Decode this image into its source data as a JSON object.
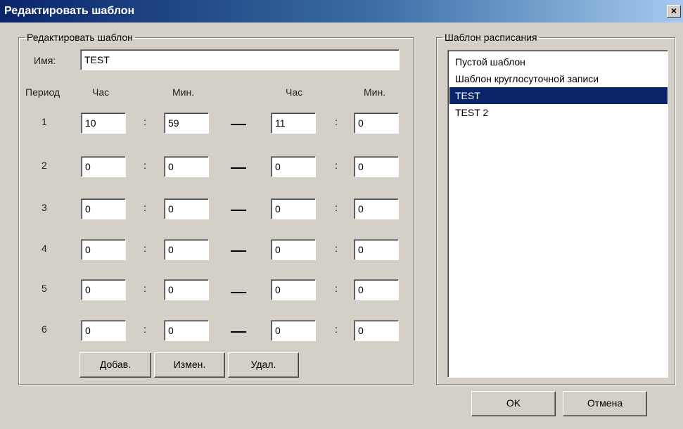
{
  "window": {
    "title": "Редактировать шаблон",
    "close_glyph": "×"
  },
  "edit_group": {
    "legend": "Редактировать шаблон",
    "name_label": "Имя:",
    "name_value": "TEST",
    "headers": {
      "period": "Период",
      "hour1": "Час",
      "min1": "Мин.",
      "hour2": "Час",
      "min2": "Мин."
    },
    "colon": ":",
    "periods": [
      {
        "num": "1",
        "start_hour": "10",
        "start_min": "59",
        "end_hour": "11",
        "end_min": "0"
      },
      {
        "num": "2",
        "start_hour": "0",
        "start_min": "0",
        "end_hour": "0",
        "end_min": "0"
      },
      {
        "num": "3",
        "start_hour": "0",
        "start_min": "0",
        "end_hour": "0",
        "end_min": "0"
      },
      {
        "num": "4",
        "start_hour": "0",
        "start_min": "0",
        "end_hour": "0",
        "end_min": "0"
      },
      {
        "num": "5",
        "start_hour": "0",
        "start_min": "0",
        "end_hour": "0",
        "end_min": "0"
      },
      {
        "num": "6",
        "start_hour": "0",
        "start_min": "0",
        "end_hour": "0",
        "end_min": "0"
      }
    ],
    "buttons": {
      "add": "Добав.",
      "edit": "Измен.",
      "delete": "Удал."
    }
  },
  "list_group": {
    "legend": "Шаблон расписания",
    "items": [
      {
        "label": "Пустой шаблон",
        "selected": false
      },
      {
        "label": "Шаблон круглосуточной записи",
        "selected": false
      },
      {
        "label": "TEST",
        "selected": true
      },
      {
        "label": "TEST 2",
        "selected": false
      }
    ]
  },
  "footer": {
    "ok": "OK",
    "cancel": "Отмена"
  },
  "colors": {
    "selection": "#0a246a",
    "face": "#d4d0c8"
  }
}
